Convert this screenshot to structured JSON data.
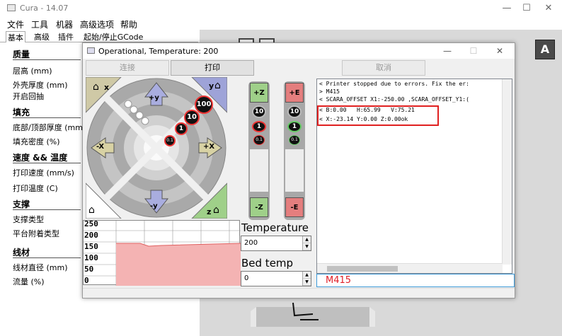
{
  "app": {
    "title": "Cura - 14.07",
    "minimize": "—",
    "maximize": "☐",
    "close": "✕"
  },
  "menu": [
    "文件",
    "工具",
    "机器",
    "高级选项",
    "帮助"
  ],
  "tabs": [
    "基本",
    "高级",
    "插件",
    "起始/停止GCode"
  ],
  "settings": {
    "quality": "质量",
    "layer_height": "层高 (mm)",
    "shell_thickness": "外壳厚度 (mm)",
    "retraction": "开启回抽",
    "fill": "填充",
    "bottom_top": "底部/顶部厚度 (mm)",
    "fill_density": "填充密度 (%)",
    "speed_temp": "速度 && 温度",
    "print_speed": "打印速度 (mm/s)",
    "print_temp": "打印温度 (C)",
    "support": "支撑",
    "support_type": "支撑类型",
    "adhesion": "平台附着类型",
    "filament": "线材",
    "diameter": "线材直径 (mm)",
    "flow": "流量 (%)"
  },
  "viewport": {
    "logo_text": "A"
  },
  "dialog": {
    "title": "Operational, Temperature: 200",
    "connect": "连接",
    "print": "打印",
    "cancel": "取消",
    "jog": {
      "plus_x": "+X",
      "minus_x": "-X",
      "plus_y": "+y",
      "minus_y": "-y",
      "x_home": "x",
      "y_home": "y",
      "z_home": "z",
      "steps": [
        "100",
        "10",
        "1",
        "0.1"
      ]
    },
    "z_axis": {
      "up": "+Z",
      "down": "-Z",
      "steps": [
        "10",
        "1",
        "0.1"
      ]
    },
    "e_axis": {
      "up": "+E",
      "down": "-E",
      "steps": [
        "10",
        "1",
        "0.1"
      ]
    },
    "graph_labels": [
      "250",
      "200",
      "150",
      "100",
      "50",
      "0"
    ],
    "temperature_label": "Temperature",
    "temperature_value": "200",
    "bed_label": "Bed temp",
    "bed_value": "0",
    "console_lines": [
      "< Printer stopped due to errors. Fix the er:",
      "> M415",
      "< SCARA_OFFSET X1:-250.00 ,SCARA_OFFSET_Y1:(",
      "< B:0.00   H:65.99   V:75.21",
      "< X:-23.14 Y:0.00 Z:0.00ok"
    ],
    "command": "M415"
  },
  "colors": {
    "graph_fill": "#f4b3b3",
    "graph_line": "#e06060",
    "highlight": "#e02020"
  }
}
